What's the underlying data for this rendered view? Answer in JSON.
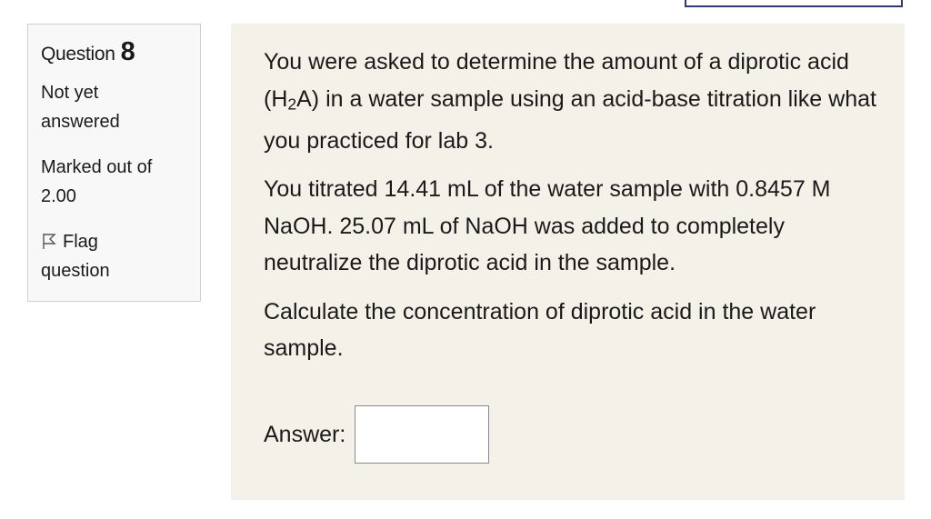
{
  "question": {
    "label": "Question",
    "number": "8",
    "state_line1": "Not yet",
    "state_line2": "answered",
    "grade_line1": "Marked out of",
    "grade_line2": "2.00",
    "flag_line1": "Flag",
    "flag_line2": "question",
    "flag_icon": "flag-outline-icon"
  },
  "body": {
    "p1_a": "You were asked to determine the amount of a diprotic acid (H",
    "p1_sub": "2",
    "p1_b": "A) in a water sample using an acid-base titration like what you practiced for lab 3.",
    "p2": "You titrated 14.41 mL of the water sample with 0.8457 M NaOH. 25.07 mL of NaOH was added to completely neutralize the diprotic acid in the sample.",
    "p3": "Calculate the concentration of diprotic acid in the water sample."
  },
  "answer": {
    "label": "Answer:",
    "value": ""
  },
  "colors": {
    "content_bg": "#f4f2e8",
    "info_bg": "#f8f8f8",
    "top_box_border": "#2b3a7a"
  }
}
